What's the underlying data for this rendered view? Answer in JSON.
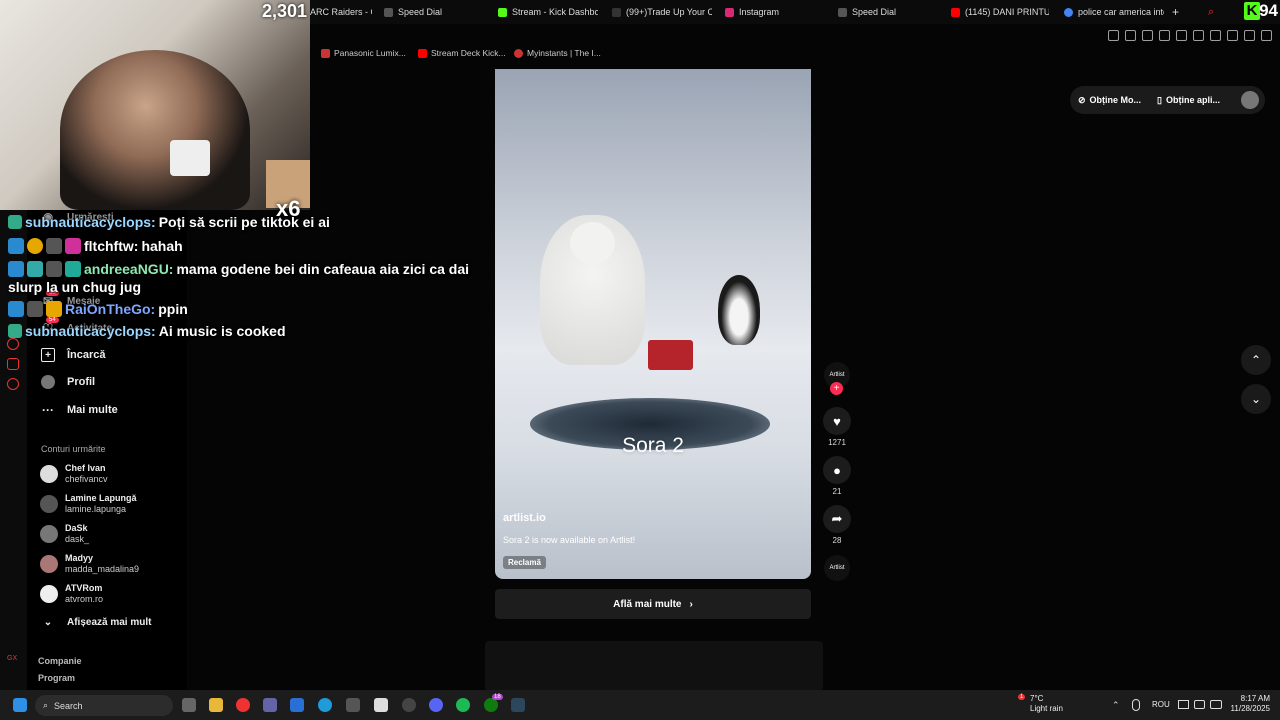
{
  "tabs": [
    {
      "label": "ARC Raiders - Of",
      "color": "#c33"
    },
    {
      "label": "Speed Dial",
      "color": "#555"
    },
    {
      "label": "Stream - Kick Dashboa",
      "color": "#53fc18"
    },
    {
      "label": "(99+)Trade Up Your Co",
      "color": "#222"
    },
    {
      "label": "Instagram",
      "color": "#d62976"
    },
    {
      "label": "Speed Dial",
      "color": "#555"
    },
    {
      "label": "(1145) DANI PRINTUL B",
      "color": "#f00"
    },
    {
      "label": "police car america inte",
      "color": "#4285f4"
    }
  ],
  "bookmarks": [
    {
      "label": "Panasonic Lumix...",
      "color": "#c33"
    },
    {
      "label": "Stream Deck Kick...",
      "color": "#f00"
    },
    {
      "label": "Myinstants | The I...",
      "color": "#c33"
    }
  ],
  "stream": {
    "viewers": "2,301",
    "kick_count": "94",
    "kick_logo": "K",
    "multiplier": "x6"
  },
  "chat": [
    {
      "user": "subnauticacyclops:",
      "user_color": "#9bd7ff",
      "text": "Poți să scrii pe tiktok ei ai"
    },
    {
      "user": "fltchftw:",
      "user_color": "#ffffff",
      "text": "hahah"
    },
    {
      "user": "andreeaNGU:",
      "user_color": "#8fe8b0",
      "text": "mama godene bei din cafeaua aia zici ca dai"
    },
    {
      "user": "",
      "user_color": "#ffffff",
      "text": "slurp la un chug jug"
    },
    {
      "user": "RaiOnTheGo:",
      "user_color": "#7fa7ff",
      "text": "ppin"
    },
    {
      "user": "subnauticacyclops:",
      "user_color": "#9bd7ff",
      "text": "Ai music is cooked"
    }
  ],
  "sidebar": {
    "items": [
      {
        "label": "Urmărești",
        "icon": "following-icon"
      },
      {
        "label": "Mesaje",
        "icon": "message-icon"
      },
      {
        "label": "Activitate",
        "icon": "activity-icon"
      },
      {
        "label": "Încarcă",
        "icon": "upload-icon"
      },
      {
        "label": "Profil",
        "icon": "profile-icon"
      },
      {
        "label": "Mai multe",
        "icon": "more-icon"
      }
    ],
    "badges": {
      "messages": "53",
      "activity": "54"
    },
    "following_title": "Conturi urmărite",
    "following": [
      {
        "name": "Chef Ivan",
        "user": "chefivancv"
      },
      {
        "name": "Lamine Lapungă",
        "user": "lamine.lapunga"
      },
      {
        "name": "DaSk",
        "user": "dask_"
      },
      {
        "name": "Madyy",
        "user": "madda_madalina9"
      },
      {
        "name": "ATVRom",
        "user": "atvrom.ro"
      }
    ],
    "show_more": "Afișează mai mult",
    "company": "Companie",
    "program": "Program"
  },
  "video": {
    "overlay_text": "Sora 2",
    "author": "artlist.io",
    "description": "Sora 2 is now available on Artlist!",
    "tag": "Reclamă",
    "cta": "Află mai multe",
    "avatar_label": "Artlist",
    "likes": "1271",
    "comments": "21",
    "shares": "28"
  },
  "top_right": {
    "get_more": "Obține Mo...",
    "get_app": "Obține apli..."
  },
  "taskbar": {
    "search": "Search",
    "temp": "7°C",
    "weather": "Light rain",
    "lang": "ROU",
    "time": "8:17 AM",
    "date": "11/28/2025",
    "weather_badge": "1",
    "app_badge": "18"
  },
  "colors": {
    "accent": "#fe2c55",
    "kick": "#53fc18"
  }
}
